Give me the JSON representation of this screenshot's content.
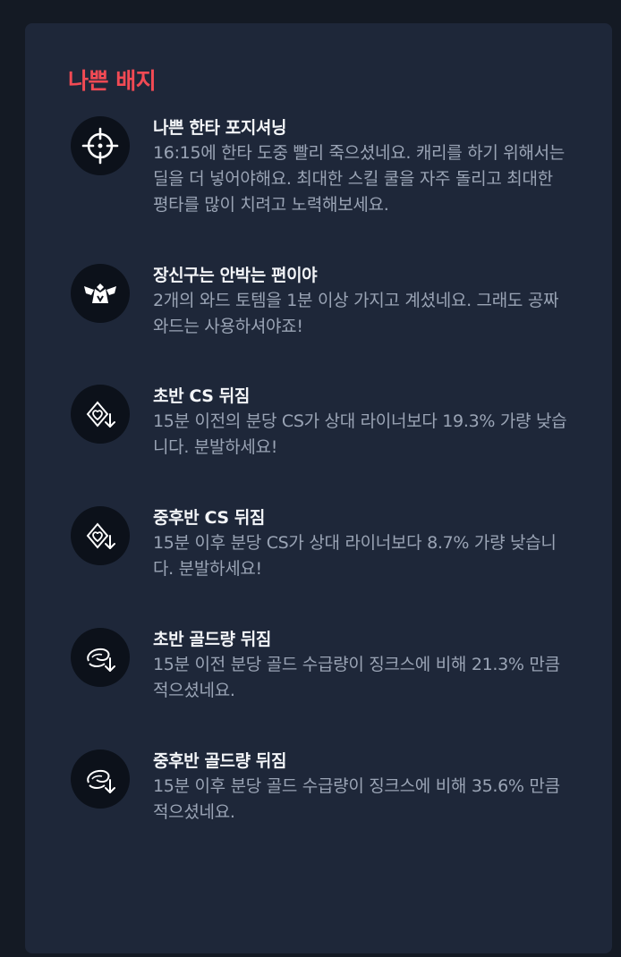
{
  "section": {
    "title": "나쁜 배지"
  },
  "colors": {
    "title_red": "#f24a54",
    "card_bg": "#1e2739",
    "icon_bg": "#0c111a"
  },
  "badges": [
    {
      "icon": "crosshair-icon",
      "title": "나쁜 한타 포지셔닝",
      "desc": "16:15에 한타 도중 빨리 죽으셨네요. 캐리를 하기 위해서는 딜을 더 넣어야해요. 최대한 스킬 쿨을 자주 돌리고 최대한 평타를 많이 치려고 노력해보세요."
    },
    {
      "icon": "ward-totem-icon",
      "title": "장신구는 안박는 편이야",
      "desc": "2개의 와드 토템을 1분 이상 가지고 계셨네요. 그래도 공짜 와드는 사용하셔야죠!"
    },
    {
      "icon": "cs-down-icon",
      "title": "초반 CS 뒤짐",
      "desc": "15분 이전의 분당 CS가 상대 라이너보다 19.3% 가량 낮습니다. 분발하세요!"
    },
    {
      "icon": "cs-down-icon",
      "title": "중후반 CS 뒤짐",
      "desc": "15분 이후 분당 CS가 상대 라이너보다 8.7% 가량 낮습니다. 분발하세요!"
    },
    {
      "icon": "gold-down-icon",
      "title": "초반 골드량 뒤짐",
      "desc": "15분 이전 분당 골드 수급량이 징크스에 비해 21.3% 만큼 적으셨네요."
    },
    {
      "icon": "gold-down-icon",
      "title": "중후반 골드량 뒤짐",
      "desc": "15분 이후 분당 골드 수급량이 징크스에 비해 35.6% 만큼 적으셨네요."
    }
  ]
}
